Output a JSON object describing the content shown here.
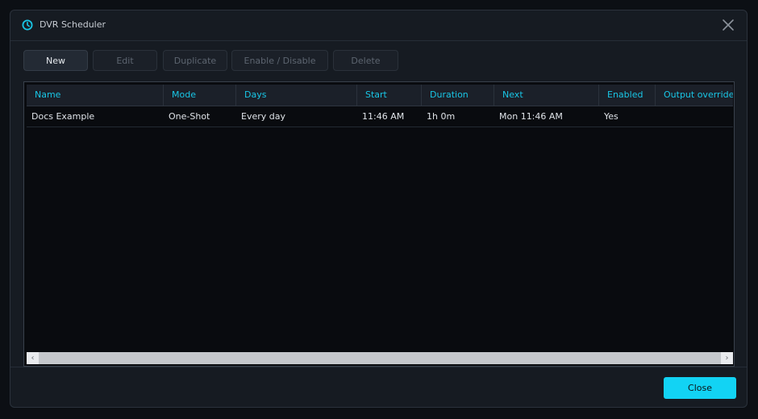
{
  "window": {
    "title": "DVR Scheduler",
    "icon": "clock-icon",
    "close_icon": "close-icon"
  },
  "toolbar": {
    "new": "New",
    "edit": "Edit",
    "duplicate": "Duplicate",
    "enable_disable": "Enable / Disable",
    "delete": "Delete"
  },
  "table": {
    "columns": [
      "Name",
      "Mode",
      "Days",
      "Start",
      "Duration",
      "Next",
      "Enabled",
      "Output override"
    ],
    "rows": [
      {
        "name": "Docs Example",
        "mode": "One-Shot",
        "days": "Every day",
        "start": "11:46 AM",
        "duration": "1h 0m",
        "next": "Mon 11:46 AM",
        "enabled": "Yes",
        "output_override": ""
      }
    ]
  },
  "scrollbar": {
    "left_arrow": "‹",
    "right_arrow": "›"
  },
  "footer": {
    "close": "Close"
  },
  "colors": {
    "accent": "#19c6e6",
    "primary_button": "#12d3f4",
    "background": "#161b22",
    "table_background": "#090b0f"
  }
}
